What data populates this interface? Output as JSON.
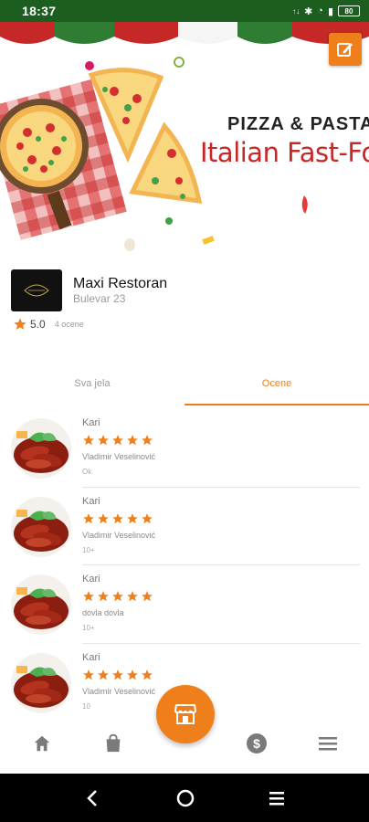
{
  "status_bar": {
    "time": "18:37",
    "battery": "80"
  },
  "hero": {
    "title": "PIZZA & PASTA",
    "subtitle": "Italian Fast-Food"
  },
  "restaurant": {
    "name": "Maxi Restoran",
    "address": "Bulevar 23",
    "rating": "5.0",
    "review_count": "4 ocene"
  },
  "tabs": [
    {
      "label": "Sva jela",
      "active": false
    },
    {
      "label": "Ocene",
      "active": true
    }
  ],
  "reviews": [
    {
      "dish": "Kari",
      "stars": 5,
      "reviewer": "Vladimir Veselinović",
      "comment": "Ok"
    },
    {
      "dish": "Kari",
      "stars": 5,
      "reviewer": "Vladimir Veselinović",
      "comment": "10+"
    },
    {
      "dish": "Kari",
      "stars": 5,
      "reviewer": "dovla dovla",
      "comment": "10+"
    },
    {
      "dish": "Kari",
      "stars": 5,
      "reviewer": "Vladimir Veselinović",
      "comment": "10"
    }
  ],
  "bottom_nav": {
    "items": [
      "home-icon",
      "shopping-bag-icon",
      "store-icon",
      "dollar-icon",
      "menu-icon"
    ]
  },
  "colors": {
    "accent": "#ef7f1a",
    "status_bar": "#1b5e20",
    "hero_subtitle": "#c62828"
  }
}
